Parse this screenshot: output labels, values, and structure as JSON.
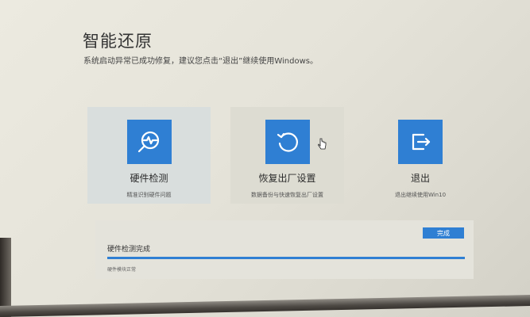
{
  "page": {
    "title": "智能还原",
    "subtitle": "系统启动异常已成功修复，建议您点击“退出”继续使用Windows。"
  },
  "options": [
    {
      "label": "硬件检测",
      "desc": "精准识别硬件问题",
      "icon": "hardware-detect-icon"
    },
    {
      "label": "恢复出厂设置",
      "desc": "数据备份与快速恢复出厂设置",
      "icon": "restore-icon"
    },
    {
      "label": "退出",
      "desc": "退出继续使用Win10",
      "icon": "exit-icon"
    }
  ],
  "progress": {
    "button_label": "完成",
    "label": "硬件检测完成",
    "sub_label": "硬件模块正常",
    "percent": 100
  },
  "colors": {
    "accent": "#2f7fd3",
    "background": "#e6e4da"
  }
}
